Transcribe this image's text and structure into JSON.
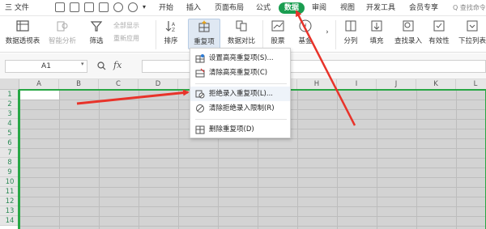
{
  "menubar": {
    "file_label": "三 文件",
    "tabs": [
      "开始",
      "插入",
      "页面布局",
      "公式",
      "数据",
      "审阅",
      "视图",
      "开发工具",
      "会员专享"
    ],
    "active_tab": "数据",
    "search_label": "Q 查找命令"
  },
  "ribbon": {
    "pivot_label": "数据透视表",
    "smart_label": "智能分析",
    "filter_label": "筛选",
    "show_all_label": "全部显示",
    "reapply_label": "重新应用",
    "sort_label": "排序",
    "duplicates_label": "重复项",
    "compare_label": "数据对比",
    "stocks_label": "股票",
    "fund_label": "基金",
    "split_label": "分列",
    "fill_label": "填充",
    "lookup_label": "查找录入",
    "validity_label": "有效性",
    "dropdown_label": "下拉列表"
  },
  "formula_bar": {
    "cell_ref": "A1",
    "fx_label": "fx"
  },
  "sheet": {
    "columns": [
      "A",
      "B",
      "C",
      "D",
      "E",
      "F",
      "G",
      "H",
      "I",
      "J",
      "K",
      "L"
    ],
    "rows": [
      "1",
      "2",
      "3",
      "4",
      "5",
      "6",
      "7",
      "8",
      "9",
      "10",
      "11",
      "12",
      "13",
      "14"
    ]
  },
  "dropdown": {
    "items": [
      {
        "label": "设置高亮重复项(S)...",
        "icon": "highlight-icon"
      },
      {
        "label": "清除高亮重复项(C)",
        "icon": "clear-highlight-icon"
      },
      {
        "label": "拒绝录入重复项(L)...",
        "icon": "reject-entry-icon"
      },
      {
        "label": "清除拒绝录入限制(R)",
        "icon": "clear-reject-icon"
      },
      {
        "label": "删除重复项(D)",
        "icon": "delete-duplicates-icon"
      }
    ]
  },
  "colors": {
    "accent_green": "#1a9d50",
    "arrow_red": "#e8332a",
    "selection_green": "#28a745"
  }
}
